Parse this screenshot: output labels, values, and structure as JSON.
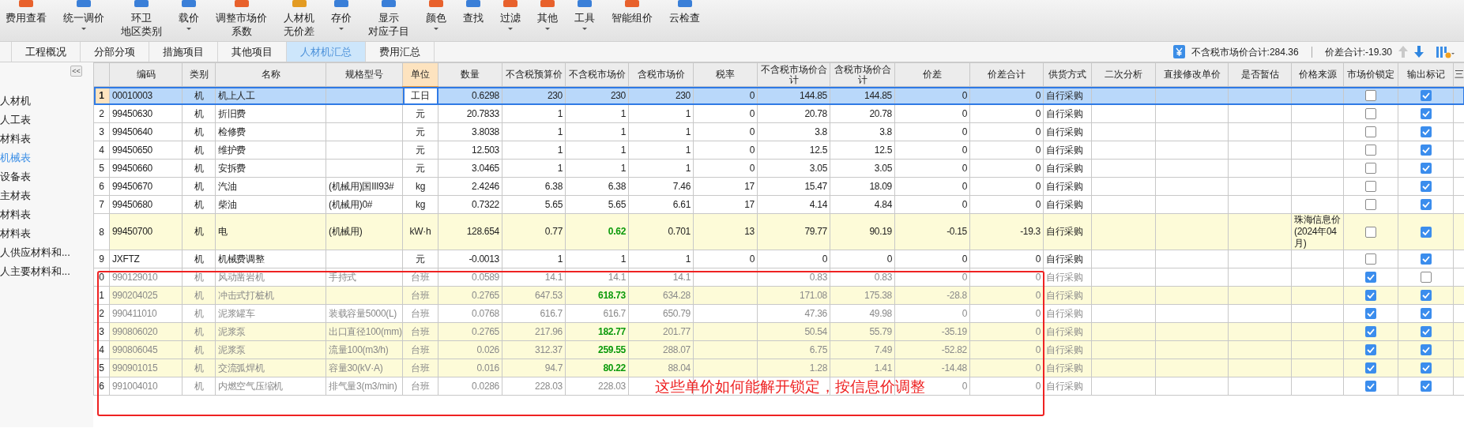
{
  "toolbar": [
    {
      "lines": [
        "费用查看"
      ],
      "dropdown": false
    },
    {
      "lines": [
        "统一调价"
      ],
      "dropdown": true
    },
    {
      "lines": [
        "环卫",
        "地区类别"
      ],
      "dropdown": false
    },
    {
      "lines": [
        "载价"
      ],
      "dropdown": true
    },
    {
      "lines": [
        "调整市场价",
        "系数"
      ],
      "dropdown": false
    },
    {
      "lines": [
        "人材机",
        "无价差"
      ],
      "dropdown": false
    },
    {
      "lines": [
        "存价"
      ],
      "dropdown": true
    },
    {
      "lines": [
        "显示",
        "对应子目"
      ],
      "dropdown": false
    },
    {
      "lines": [
        "颜色"
      ],
      "dropdown": true
    },
    {
      "lines": [
        "查找"
      ],
      "dropdown": false
    },
    {
      "lines": [
        "过滤"
      ],
      "dropdown": true
    },
    {
      "lines": [
        "其他"
      ],
      "dropdown": true
    },
    {
      "lines": [
        "工具"
      ],
      "dropdown": true
    },
    {
      "lines": [
        "智能组价"
      ],
      "dropdown": false
    },
    {
      "lines": [
        "云检查"
      ],
      "dropdown": false
    }
  ],
  "tabs": [
    {
      "label": "工程概况",
      "selected": false
    },
    {
      "label": "分部分项",
      "selected": false
    },
    {
      "label": "措施项目",
      "selected": false
    },
    {
      "label": "其他项目",
      "selected": false
    },
    {
      "label": "人材机汇总",
      "selected": true
    },
    {
      "label": "费用汇总",
      "selected": false
    }
  ],
  "summary": {
    "market_total": "不含税市场价合计:284.36",
    "diff_total": "价差合计:-19.30"
  },
  "sidebar": {
    "collapse": "<<",
    "items": [
      {
        "label": "人材机",
        "selected": false
      },
      {
        "label": "人工表",
        "selected": false
      },
      {
        "label": "材料表",
        "selected": false
      },
      {
        "label": "机械表",
        "selected": true
      },
      {
        "label": "设备表",
        "selected": false
      },
      {
        "label": "主材表",
        "selected": false
      },
      {
        "label": "材料表",
        "selected": false
      },
      {
        "label": "材料表",
        "selected": false
      },
      {
        "label": "人供应材料和...",
        "selected": false
      },
      {
        "label": "人主要材料和...",
        "selected": false
      }
    ]
  },
  "table": {
    "columns": [
      {
        "label": "编码",
        "selected": false
      },
      {
        "label": "类别",
        "selected": false
      },
      {
        "label": "名称",
        "selected": false
      },
      {
        "label": "规格型号",
        "selected": false
      },
      {
        "label": "单位",
        "selected": true
      },
      {
        "label": "数量",
        "selected": false
      },
      {
        "label": "不含税预算价",
        "selected": false
      },
      {
        "label": "不含税市场价",
        "selected": false
      },
      {
        "label": "含税市场价",
        "selected": false
      },
      {
        "label": "税率",
        "selected": false
      },
      {
        "label": "不含税市场价合计",
        "selected": false
      },
      {
        "label": "含税市场价合计",
        "selected": false
      },
      {
        "label": "价差",
        "selected": false
      },
      {
        "label": "价差合计",
        "selected": false
      },
      {
        "label": "供货方式",
        "selected": false
      },
      {
        "label": "二次分析",
        "selected": false
      },
      {
        "label": "直接修改单价",
        "selected": false
      },
      {
        "label": "是否暂估",
        "selected": false
      },
      {
        "label": "价格来源",
        "selected": false
      },
      {
        "label": "市场价锁定",
        "selected": false
      },
      {
        "label": "输出标记",
        "selected": false
      },
      {
        "label": "三",
        "selected": false
      }
    ],
    "rows": [
      {
        "no": "1",
        "code": "00010003",
        "type": "机",
        "name": "机上人工",
        "unit": "工日",
        "qty": "0.6298",
        "budget_price": "230",
        "market_price": "230",
        "tax_price": "230",
        "tax_rate": "0",
        "market_total": "144.85",
        "tax_total": "144.85",
        "diff": "0",
        "diff_total": "0",
        "supply": "自行采购",
        "locked": false,
        "output": true,
        "selected": true,
        "highlighted": false,
        "greyed": false,
        "adjusted": false
      },
      {
        "no": "2",
        "code": "99450630",
        "type": "机",
        "name": "折旧费",
        "unit": "元",
        "qty": "20.7833",
        "budget_price": "1",
        "market_price": "1",
        "tax_price": "1",
        "tax_rate": "0",
        "market_total": "20.78",
        "tax_total": "20.78",
        "diff": "0",
        "diff_total": "0",
        "supply": "自行采购",
        "locked": false,
        "output": true,
        "selected": false,
        "highlighted": false,
        "greyed": false,
        "adjusted": false
      },
      {
        "no": "3",
        "code": "99450640",
        "type": "机",
        "name": "检修费",
        "unit": "元",
        "qty": "3.8038",
        "budget_price": "1",
        "market_price": "1",
        "tax_price": "1",
        "tax_rate": "0",
        "market_total": "3.8",
        "tax_total": "3.8",
        "diff": "0",
        "diff_total": "0",
        "supply": "自行采购",
        "locked": false,
        "output": true,
        "selected": false,
        "highlighted": false,
        "greyed": false,
        "adjusted": false
      },
      {
        "no": "4",
        "code": "99450650",
        "type": "机",
        "name": "维护费",
        "unit": "元",
        "qty": "12.503",
        "budget_price": "1",
        "market_price": "1",
        "tax_price": "1",
        "tax_rate": "0",
        "market_total": "12.5",
        "tax_total": "12.5",
        "diff": "0",
        "diff_total": "0",
        "supply": "自行采购",
        "locked": false,
        "output": true,
        "selected": false,
        "highlighted": false,
        "greyed": false,
        "adjusted": false
      },
      {
        "no": "5",
        "code": "99450660",
        "type": "机",
        "name": "安拆费",
        "unit": "元",
        "qty": "3.0465",
        "budget_price": "1",
        "market_price": "1",
        "tax_price": "1",
        "tax_rate": "0",
        "market_total": "3.05",
        "tax_total": "3.05",
        "diff": "0",
        "diff_total": "0",
        "supply": "自行采购",
        "locked": false,
        "output": true,
        "selected": false,
        "highlighted": false,
        "greyed": false,
        "adjusted": false
      },
      {
        "no": "6",
        "code": "99450670",
        "type": "机",
        "name": "汽油",
        "spec": "(机械用)国III93#",
        "unit": "kg",
        "qty": "2.4246",
        "budget_price": "6.38",
        "market_price": "6.38",
        "tax_price": "7.46",
        "tax_rate": "17",
        "market_total": "15.47",
        "tax_total": "18.09",
        "diff": "0",
        "diff_total": "0",
        "supply": "自行采购",
        "locked": false,
        "output": true,
        "selected": false,
        "highlighted": false,
        "greyed": false,
        "adjusted": false
      },
      {
        "no": "7",
        "code": "99450680",
        "type": "机",
        "name": "柴油",
        "spec": "(机械用)0#",
        "unit": "kg",
        "qty": "0.7322",
        "budget_price": "5.65",
        "market_price": "5.65",
        "tax_price": "6.61",
        "tax_rate": "17",
        "market_total": "4.14",
        "tax_total": "4.84",
        "diff": "0",
        "diff_total": "0",
        "supply": "自行采购",
        "locked": false,
        "output": true,
        "selected": false,
        "highlighted": false,
        "greyed": false,
        "adjusted": false
      },
      {
        "no": "8",
        "code": "99450700",
        "type": "机",
        "name": "电",
        "spec": "(机械用)",
        "unit": "kW·h",
        "qty": "128.654",
        "budget_price": "0.77",
        "market_price": "0.62",
        "tax_price": "0.701",
        "tax_rate": "13",
        "market_total": "79.77",
        "tax_total": "90.19",
        "diff": "-0.15",
        "diff_total": "-19.3",
        "supply": "自行采购",
        "source": "珠海信息价(2024年04月)",
        "locked": false,
        "output": true,
        "selected": false,
        "highlighted": true,
        "greyed": false,
        "adjusted": true
      },
      {
        "no": "9",
        "code": "JXFTZ",
        "type": "机",
        "name": "机械费调整",
        "unit": "元",
        "qty": "-0.0013",
        "budget_price": "1",
        "market_price": "1",
        "tax_price": "1",
        "tax_rate": "0",
        "market_total": "0",
        "tax_total": "0",
        "diff": "0",
        "diff_total": "0",
        "supply": "自行采购",
        "locked": false,
        "output": true,
        "selected": false,
        "highlighted": false,
        "greyed": false,
        "adjusted": false
      },
      {
        "no": "0",
        "code": "990129010",
        "type": "机",
        "name": "风动凿岩机",
        "spec": "手持式",
        "unit": "台班",
        "qty": "0.0589",
        "budget_price": "14.1",
        "market_price": "14.1",
        "tax_price": "14.1",
        "market_total": "0.83",
        "tax_total": "0.83",
        "diff": "0",
        "diff_total": "0",
        "supply": "自行采购",
        "locked": true,
        "output": false,
        "selected": false,
        "highlighted": false,
        "greyed": true,
        "adjusted": false
      },
      {
        "no": "1",
        "code": "990204025",
        "type": "机",
        "name": "冲击式打桩机",
        "unit": "台班",
        "qty": "0.2765",
        "budget_price": "647.53",
        "market_price": "618.73",
        "tax_price": "634.28",
        "market_total": "171.08",
        "tax_total": "175.38",
        "diff": "-28.8",
        "diff_total": "0",
        "supply": "自行采购",
        "locked": true,
        "output": true,
        "selected": false,
        "highlighted": true,
        "greyed": true,
        "adjusted": true
      },
      {
        "no": "2",
        "code": "990411010",
        "type": "机",
        "name": "泥浆罐车",
        "spec": "装载容量5000(L)",
        "unit": "台班",
        "qty": "0.0768",
        "budget_price": "616.7",
        "market_price": "616.7",
        "tax_price": "650.79",
        "market_total": "47.36",
        "tax_total": "49.98",
        "diff": "0",
        "diff_total": "0",
        "supply": "自行采购",
        "locked": true,
        "output": true,
        "selected": false,
        "highlighted": false,
        "greyed": true,
        "adjusted": false
      },
      {
        "no": "3",
        "code": "990806020",
        "type": "机",
        "name": "泥浆泵",
        "spec": "出口直径100(mm)",
        "unit": "台班",
        "qty": "0.2765",
        "budget_price": "217.96",
        "market_price": "182.77",
        "tax_price": "201.77",
        "market_total": "50.54",
        "tax_total": "55.79",
        "diff": "-35.19",
        "diff_total": "0",
        "supply": "自行采购",
        "locked": true,
        "output": true,
        "selected": false,
        "highlighted": true,
        "greyed": true,
        "adjusted": true
      },
      {
        "no": "4",
        "code": "990806045",
        "type": "机",
        "name": "泥浆泵",
        "spec": "流量100(m3/h)",
        "unit": "台班",
        "qty": "0.026",
        "budget_price": "312.37",
        "market_price": "259.55",
        "tax_price": "288.07",
        "market_total": "6.75",
        "tax_total": "7.49",
        "diff": "-52.82",
        "diff_total": "0",
        "supply": "自行采购",
        "locked": true,
        "output": true,
        "selected": false,
        "highlighted": true,
        "greyed": true,
        "adjusted": true
      },
      {
        "no": "5",
        "code": "990901015",
        "type": "机",
        "name": "交流弧焊机",
        "spec": "容量30(kV·A)",
        "unit": "台班",
        "qty": "0.016",
        "budget_price": "94.7",
        "market_price": "80.22",
        "tax_price": "88.04",
        "market_total": "1.28",
        "tax_total": "1.41",
        "diff": "-14.48",
        "diff_total": "0",
        "supply": "自行采购",
        "locked": true,
        "output": true,
        "selected": false,
        "highlighted": true,
        "greyed": true,
        "adjusted": true
      },
      {
        "no": "6",
        "code": "991004010",
        "type": "机",
        "name": "内燃空气压缩机",
        "spec": "排气量3(m3/min)",
        "unit": "台班",
        "qty": "0.0286",
        "budget_price": "228.03",
        "market_price": "228.03",
        "diff": "0",
        "diff_total": "0",
        "supply": "自行采购",
        "locked": true,
        "output": true,
        "selected": false,
        "highlighted": false,
        "greyed": true,
        "adjusted": false
      }
    ]
  },
  "annotation": {
    "text": "这些单价如何能解开锁定，按信息价调整"
  }
}
